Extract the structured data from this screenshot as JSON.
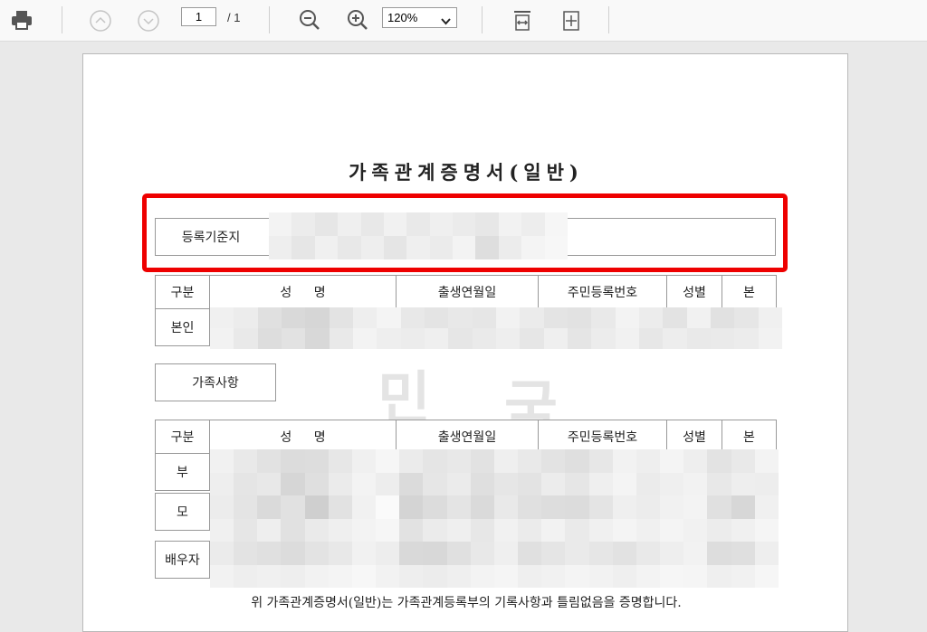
{
  "toolbar": {
    "icons": [
      "printer-icon",
      "page-up-icon",
      "page-down-icon",
      "zoom-out-icon",
      "zoom-in-icon",
      "fit-width-icon",
      "fit-page-icon"
    ],
    "page_current": "1",
    "page_total": "/ 1",
    "zoom": "120%"
  },
  "document": {
    "title": "가족관계증명서(일반)",
    "registration_label": "등록기준지",
    "table_headers": [
      "구분",
      "성 명",
      "출생연월일",
      "주민등록번호",
      "성별",
      "본"
    ],
    "self_label": "본인",
    "family_section_label": "가족사항",
    "family_rows": [
      "부",
      "모",
      "배우자"
    ],
    "footer_statement": "위 가족관계증명서(일반)는 가족관계등록부의 기록사항과 틀림없음을 증명합니다.",
    "watermark_chars": [
      "민",
      "국"
    ]
  },
  "colors": {
    "highlight": "#ee0000"
  }
}
